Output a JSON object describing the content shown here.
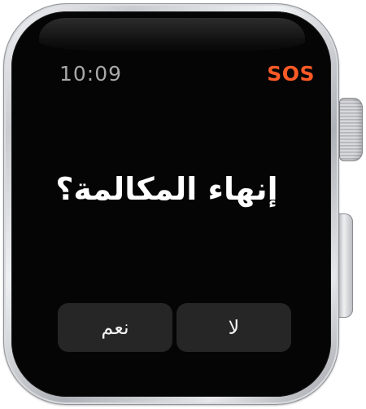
{
  "status": {
    "time": "10:09",
    "emergency_label": "SOS",
    "emergency_color": "#ff5a26"
  },
  "dialog": {
    "prompt": "إنهاء المكالمة؟",
    "yes_label": "نعم",
    "no_label": "لا"
  }
}
